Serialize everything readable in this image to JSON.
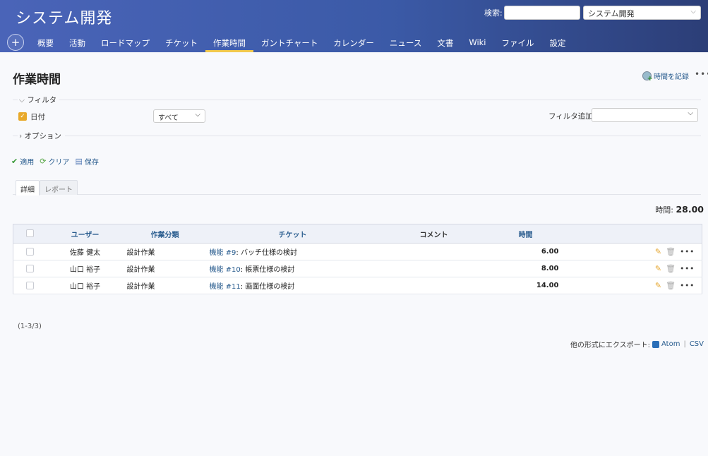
{
  "header": {
    "project_title": "システム開発",
    "search_label": "検索:",
    "search_placeholder": "",
    "project_jump_value": "システム開発",
    "new_object_icon": "plus-icon",
    "menu": [
      "概要",
      "活動",
      "ロードマップ",
      "チケット",
      "作業時間",
      "ガントチャート",
      "カレンダー",
      "ニュース",
      "文書",
      "Wiki",
      "ファイル",
      "設定"
    ],
    "selected_menu": "作業時間"
  },
  "page": {
    "title": "作業時間",
    "log_time_label": "時間を記録",
    "more_icon": "ellipsis-icon"
  },
  "filters": {
    "legend": "フィルタ",
    "date_label": "日付",
    "date_operator": "すべて",
    "add_filter_label": "フィルタ追加",
    "options_legend": "オプション"
  },
  "query_buttons": {
    "apply": "適用",
    "clear": "クリア",
    "save": "保存"
  },
  "tabs": {
    "details": "詳細",
    "report": "レポート"
  },
  "total": {
    "label": "時間:",
    "value": "28.00"
  },
  "table": {
    "headers": {
      "user": "ユーザー",
      "activity": "作業分類",
      "issue": "チケット",
      "comment": "コメント",
      "hours": "時間"
    },
    "rows": [
      {
        "user": "佐藤 健太",
        "activity": "設計作業",
        "issue_link": "機能 #9",
        "issue_subject": ": バッチ仕様の検討",
        "comment": "",
        "hours": "6.00"
      },
      {
        "user": "山口 裕子",
        "activity": "設計作業",
        "issue_link": "機能 #10",
        "issue_subject": ": 帳票仕様の検討",
        "comment": "",
        "hours": "8.00"
      },
      {
        "user": "山口 裕子",
        "activity": "設計作業",
        "issue_link": "機能 #11",
        "issue_subject": ": 画面仕様の検討",
        "comment": "",
        "hours": "14.00"
      }
    ]
  },
  "pagination": "(1-3/3)",
  "export": {
    "label": "他の形式にエクスポート:",
    "atom": "Atom",
    "separator": "|",
    "csv": "CSV"
  },
  "colors": {
    "header_start": "#4a64b8",
    "header_end": "#2c3e77",
    "link": "#2a5d8f",
    "selected_tab_underline": "#f2c94c",
    "checkbox_checked": "#e8a92a"
  }
}
